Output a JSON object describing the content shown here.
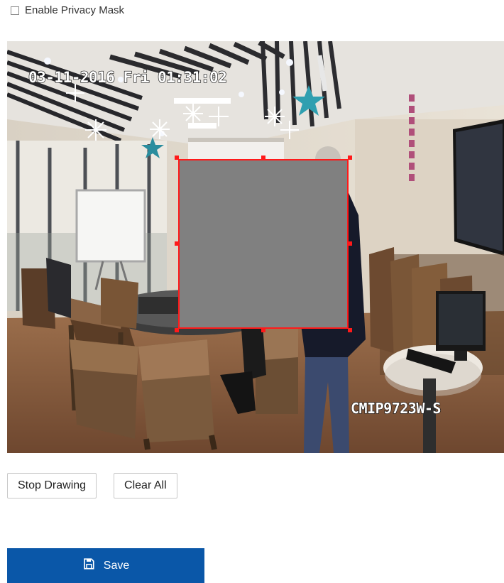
{
  "privacy_mask": {
    "label": "Enable Privacy Mask",
    "checked": false
  },
  "video": {
    "timestamp": "03-11-2016 Fri 01:31:02",
    "camera_name": "CMIP9723W-S",
    "mask_color": "#808080",
    "selection_color": "#ff1a1a"
  },
  "buttons": {
    "stop_drawing": "Stop Drawing",
    "clear_all": "Clear All",
    "save": "Save"
  },
  "colors": {
    "save_background": "#0a57a8",
    "save_text": "#ffffff"
  },
  "icons": {
    "save": "floppy-disk-icon"
  }
}
